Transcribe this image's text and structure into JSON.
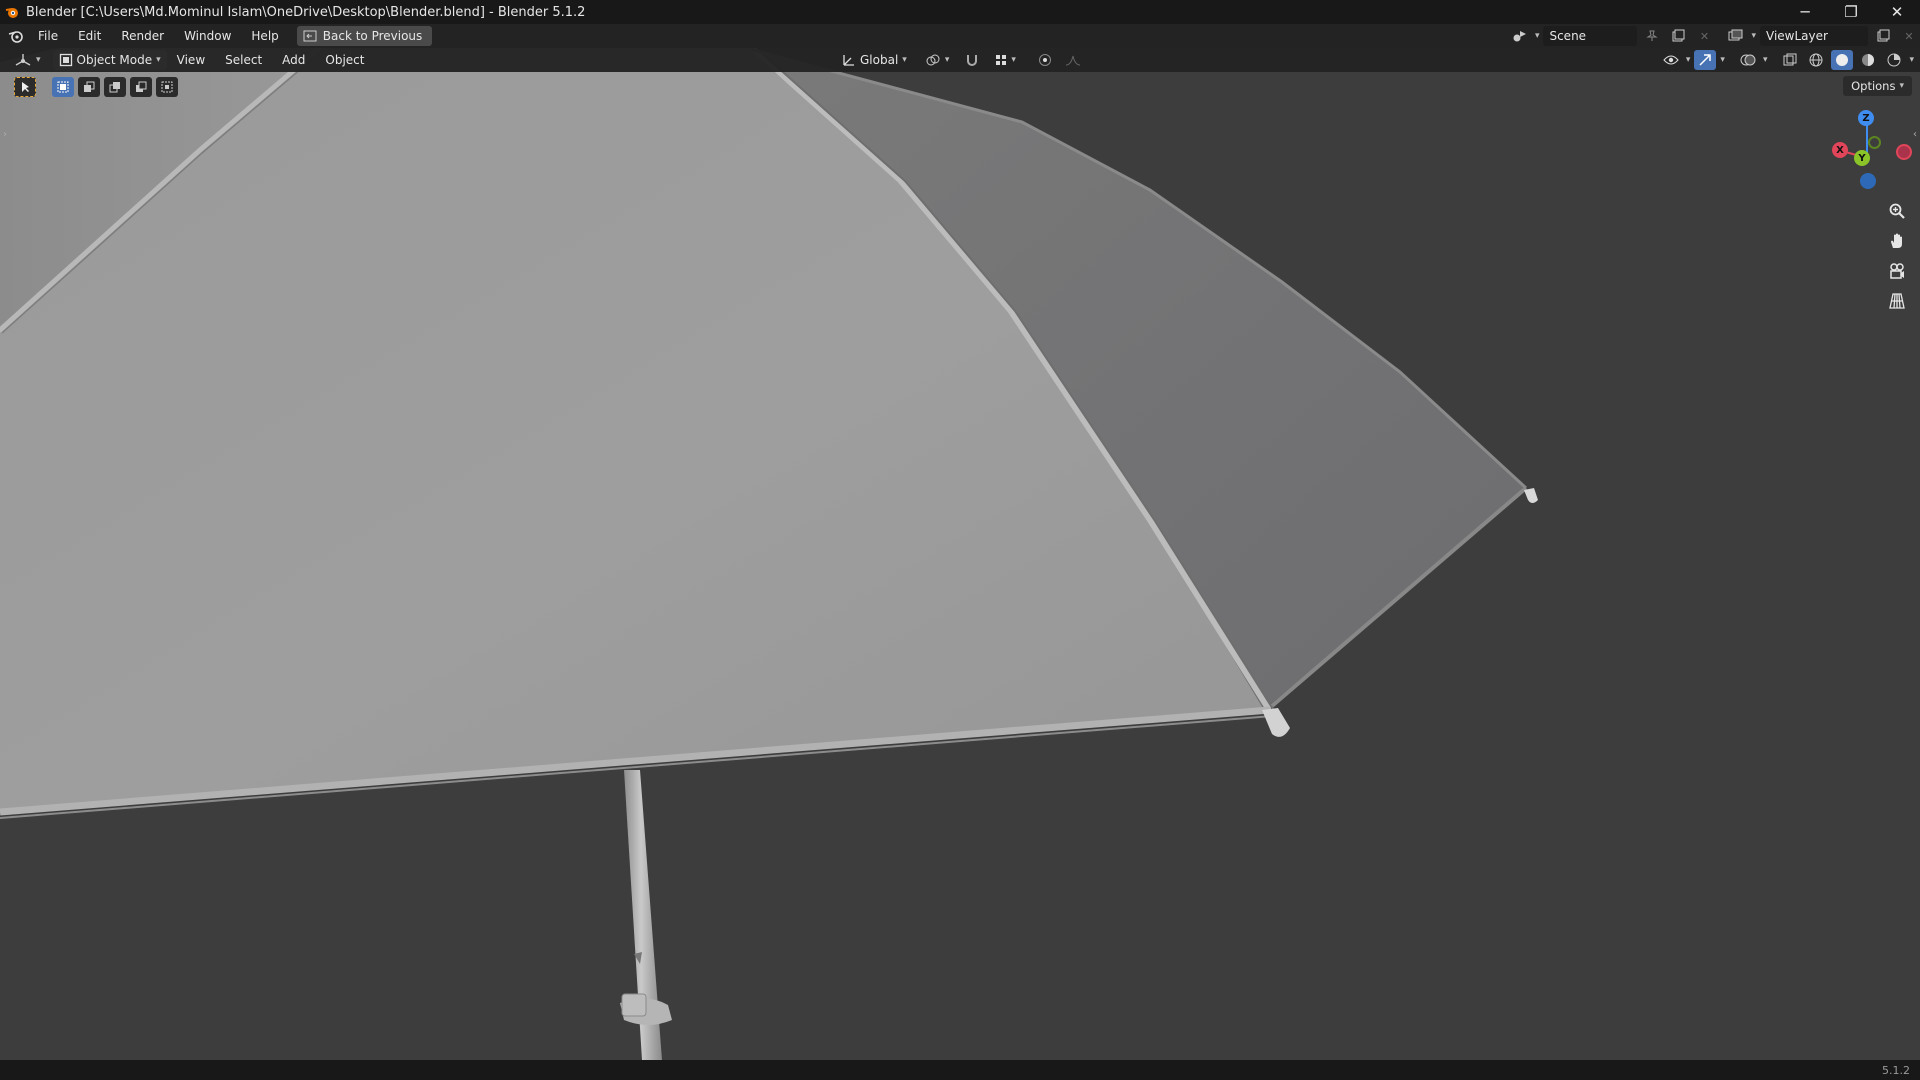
{
  "window": {
    "title": "Blender [C:\\Users\\Md.Mominul Islam\\OneDrive\\Desktop\\Blender.blend] - Blender 5.1.2",
    "controls": {
      "minimize": "─",
      "maximize": "❐",
      "close": "✕"
    }
  },
  "menubar": {
    "items": [
      "File",
      "Edit",
      "Render",
      "Window",
      "Help"
    ],
    "back_button": "Back to Previous",
    "scene": "Scene",
    "view_layer": "ViewLayer"
  },
  "viewport_header": {
    "mode": "Object Mode",
    "menus": [
      "View",
      "Select",
      "Add",
      "Object"
    ],
    "transform_orientation": "Global"
  },
  "tool_header": {
    "options_label": "Options"
  },
  "gizmo": {
    "axes": {
      "x": "X",
      "y": "Y",
      "z": "Z"
    },
    "colors": {
      "x": "#e0455a",
      "y": "#8bc428",
      "z": "#3f8df0",
      "negx": "#a8334a",
      "negy": "#5c8521",
      "negz": "#2e69b8"
    }
  },
  "status_bar": {
    "version": "5.1.2"
  },
  "colors": {
    "viewport_bg": "#3d3d3d",
    "header_bg": "#232323",
    "titlebar_bg": "#181818",
    "accent": "#4772b3"
  }
}
